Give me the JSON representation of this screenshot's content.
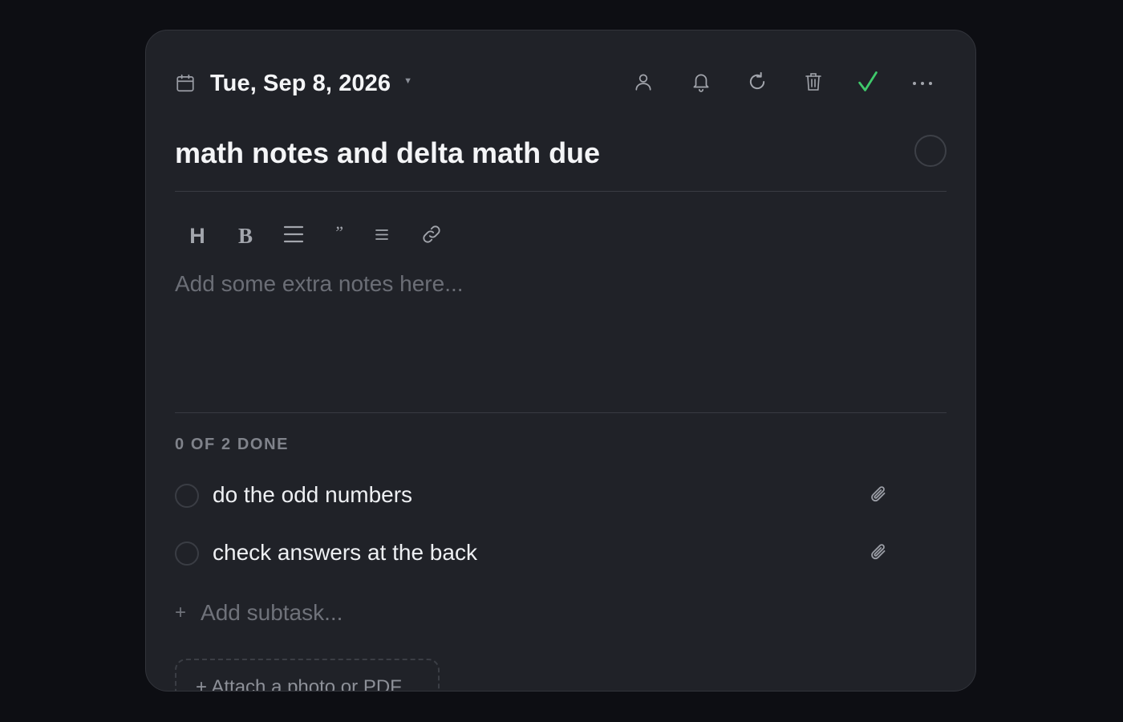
{
  "header": {
    "date": "Tue, Sep 8, 2026",
    "icons": [
      "calendar-icon",
      "chevron-down-icon",
      "person-icon",
      "bell-icon",
      "repeat-icon",
      "trash-icon",
      "check-icon",
      "more-icon"
    ]
  },
  "task": {
    "title": "math notes and delta math due",
    "completed": false
  },
  "toolbar": {
    "heading": "H",
    "bold": "B",
    "quote": "”"
  },
  "notes": {
    "placeholder": "Add some extra notes here..."
  },
  "subtasks": {
    "progress_label": "0 OF 2 DONE",
    "items": [
      {
        "label": "do the odd numbers",
        "done": false
      },
      {
        "label": "check answers at the back",
        "done": false
      }
    ],
    "add_placeholder": "Add subtask...",
    "add_symbol": "+"
  },
  "attachments": {
    "button_label": "+ Attach a photo or PDF"
  },
  "colors": {
    "background": "#0d0e13",
    "card": "#202228",
    "accent_check": "#3fca6b",
    "muted_text": "#6b6e76"
  }
}
